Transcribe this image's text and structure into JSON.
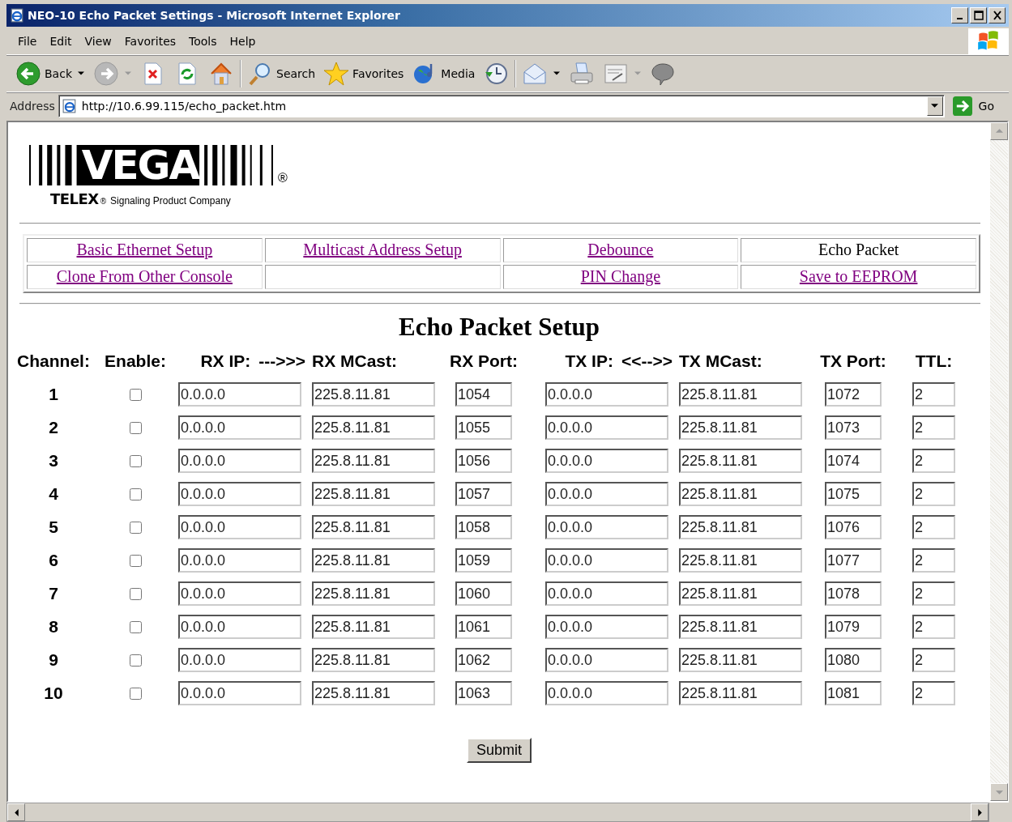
{
  "window": {
    "title": "NEO-10 Echo Packet Settings - Microsoft Internet Explorer"
  },
  "menu": [
    "File",
    "Edit",
    "View",
    "Favorites",
    "Tools",
    "Help"
  ],
  "toolbar": [
    {
      "kind": "back",
      "label": "Back"
    },
    {
      "kind": "forward"
    },
    {
      "kind": "stop"
    },
    {
      "kind": "refresh"
    },
    {
      "kind": "home"
    },
    {
      "kind": "search",
      "label": "Search"
    },
    {
      "kind": "favorites",
      "label": "Favorites"
    },
    {
      "kind": "media",
      "label": "Media"
    },
    {
      "kind": "history"
    },
    {
      "kind": "mail"
    },
    {
      "kind": "print"
    },
    {
      "kind": "edit"
    },
    {
      "kind": "discuss"
    }
  ],
  "address": {
    "label": "Address",
    "url": "http://10.6.99.115/echo_packet.htm",
    "go": "Go"
  },
  "logo": {
    "brand": "VEGA",
    "mark": "®",
    "maker": "TELEX",
    "maker_mark": "®",
    "tagline": "Signaling Product Company"
  },
  "nav": [
    [
      {
        "kind": "link",
        "label": "Basic Ethernet Setup"
      },
      {
        "kind": "link",
        "label": "Multicast Address Setup"
      },
      {
        "kind": "link",
        "label": "Debounce"
      },
      {
        "kind": "current",
        "label": "Echo Packet"
      }
    ],
    [
      {
        "kind": "link",
        "label": "Clone From Other Console"
      },
      {
        "kind": "blank"
      },
      {
        "kind": "link",
        "label": "PIN Change"
      },
      {
        "kind": "link",
        "label": "Save to EEPROM"
      }
    ]
  ],
  "heading": "Echo Packet Setup",
  "columns": {
    "channel": "Channel:",
    "enable": "Enable:",
    "rx_ip": "RX IP:",
    "rx_arrow": "--->>>",
    "rx_mcast": "RX MCast:",
    "rx_port": "RX Port:",
    "tx_ip": "TX IP:",
    "tx_arrow": "<<-->>",
    "tx_mcast": "TX MCast:",
    "tx_port": "TX Port:",
    "ttl": "TTL:"
  },
  "channels": [
    {
      "channel": "1",
      "checked": false,
      "rx_ip": "0.0.0.0",
      "rx_mcast": "225.8.11.81",
      "rx_port": "1054",
      "tx_ip": "0.0.0.0",
      "tx_mcast": "225.8.11.81",
      "tx_port": "1072",
      "ttl": "2"
    },
    {
      "channel": "2",
      "checked": false,
      "rx_ip": "0.0.0.0",
      "rx_mcast": "225.8.11.81",
      "rx_port": "1055",
      "tx_ip": "0.0.0.0",
      "tx_mcast": "225.8.11.81",
      "tx_port": "1073",
      "ttl": "2"
    },
    {
      "channel": "3",
      "checked": false,
      "rx_ip": "0.0.0.0",
      "rx_mcast": "225.8.11.81",
      "rx_port": "1056",
      "tx_ip": "0.0.0.0",
      "tx_mcast": "225.8.11.81",
      "tx_port": "1074",
      "ttl": "2"
    },
    {
      "channel": "4",
      "checked": false,
      "rx_ip": "0.0.0.0",
      "rx_mcast": "225.8.11.81",
      "rx_port": "1057",
      "tx_ip": "0.0.0.0",
      "tx_mcast": "225.8.11.81",
      "tx_port": "1075",
      "ttl": "2"
    },
    {
      "channel": "5",
      "checked": false,
      "rx_ip": "0.0.0.0",
      "rx_mcast": "225.8.11.81",
      "rx_port": "1058",
      "tx_ip": "0.0.0.0",
      "tx_mcast": "225.8.11.81",
      "tx_port": "1076",
      "ttl": "2"
    },
    {
      "channel": "6",
      "checked": false,
      "rx_ip": "0.0.0.0",
      "rx_mcast": "225.8.11.81",
      "rx_port": "1059",
      "tx_ip": "0.0.0.0",
      "tx_mcast": "225.8.11.81",
      "tx_port": "1077",
      "ttl": "2"
    },
    {
      "channel": "7",
      "checked": false,
      "rx_ip": "0.0.0.0",
      "rx_mcast": "225.8.11.81",
      "rx_port": "1060",
      "tx_ip": "0.0.0.0",
      "tx_mcast": "225.8.11.81",
      "tx_port": "1078",
      "ttl": "2"
    },
    {
      "channel": "8",
      "checked": false,
      "rx_ip": "0.0.0.0",
      "rx_mcast": "225.8.11.81",
      "rx_port": "1061",
      "tx_ip": "0.0.0.0",
      "tx_mcast": "225.8.11.81",
      "tx_port": "1079",
      "ttl": "2"
    },
    {
      "channel": "9",
      "checked": false,
      "rx_ip": "0.0.0.0",
      "rx_mcast": "225.8.11.81",
      "rx_port": "1062",
      "tx_ip": "0.0.0.0",
      "tx_mcast": "225.8.11.81",
      "tx_port": "1080",
      "ttl": "2"
    },
    {
      "channel": "10",
      "checked": false,
      "rx_ip": "0.0.0.0",
      "rx_mcast": "225.8.11.81",
      "rx_port": "1063",
      "tx_ip": "0.0.0.0",
      "tx_mcast": "225.8.11.81",
      "tx_port": "1081",
      "ttl": "2"
    }
  ],
  "submit": "Submit"
}
